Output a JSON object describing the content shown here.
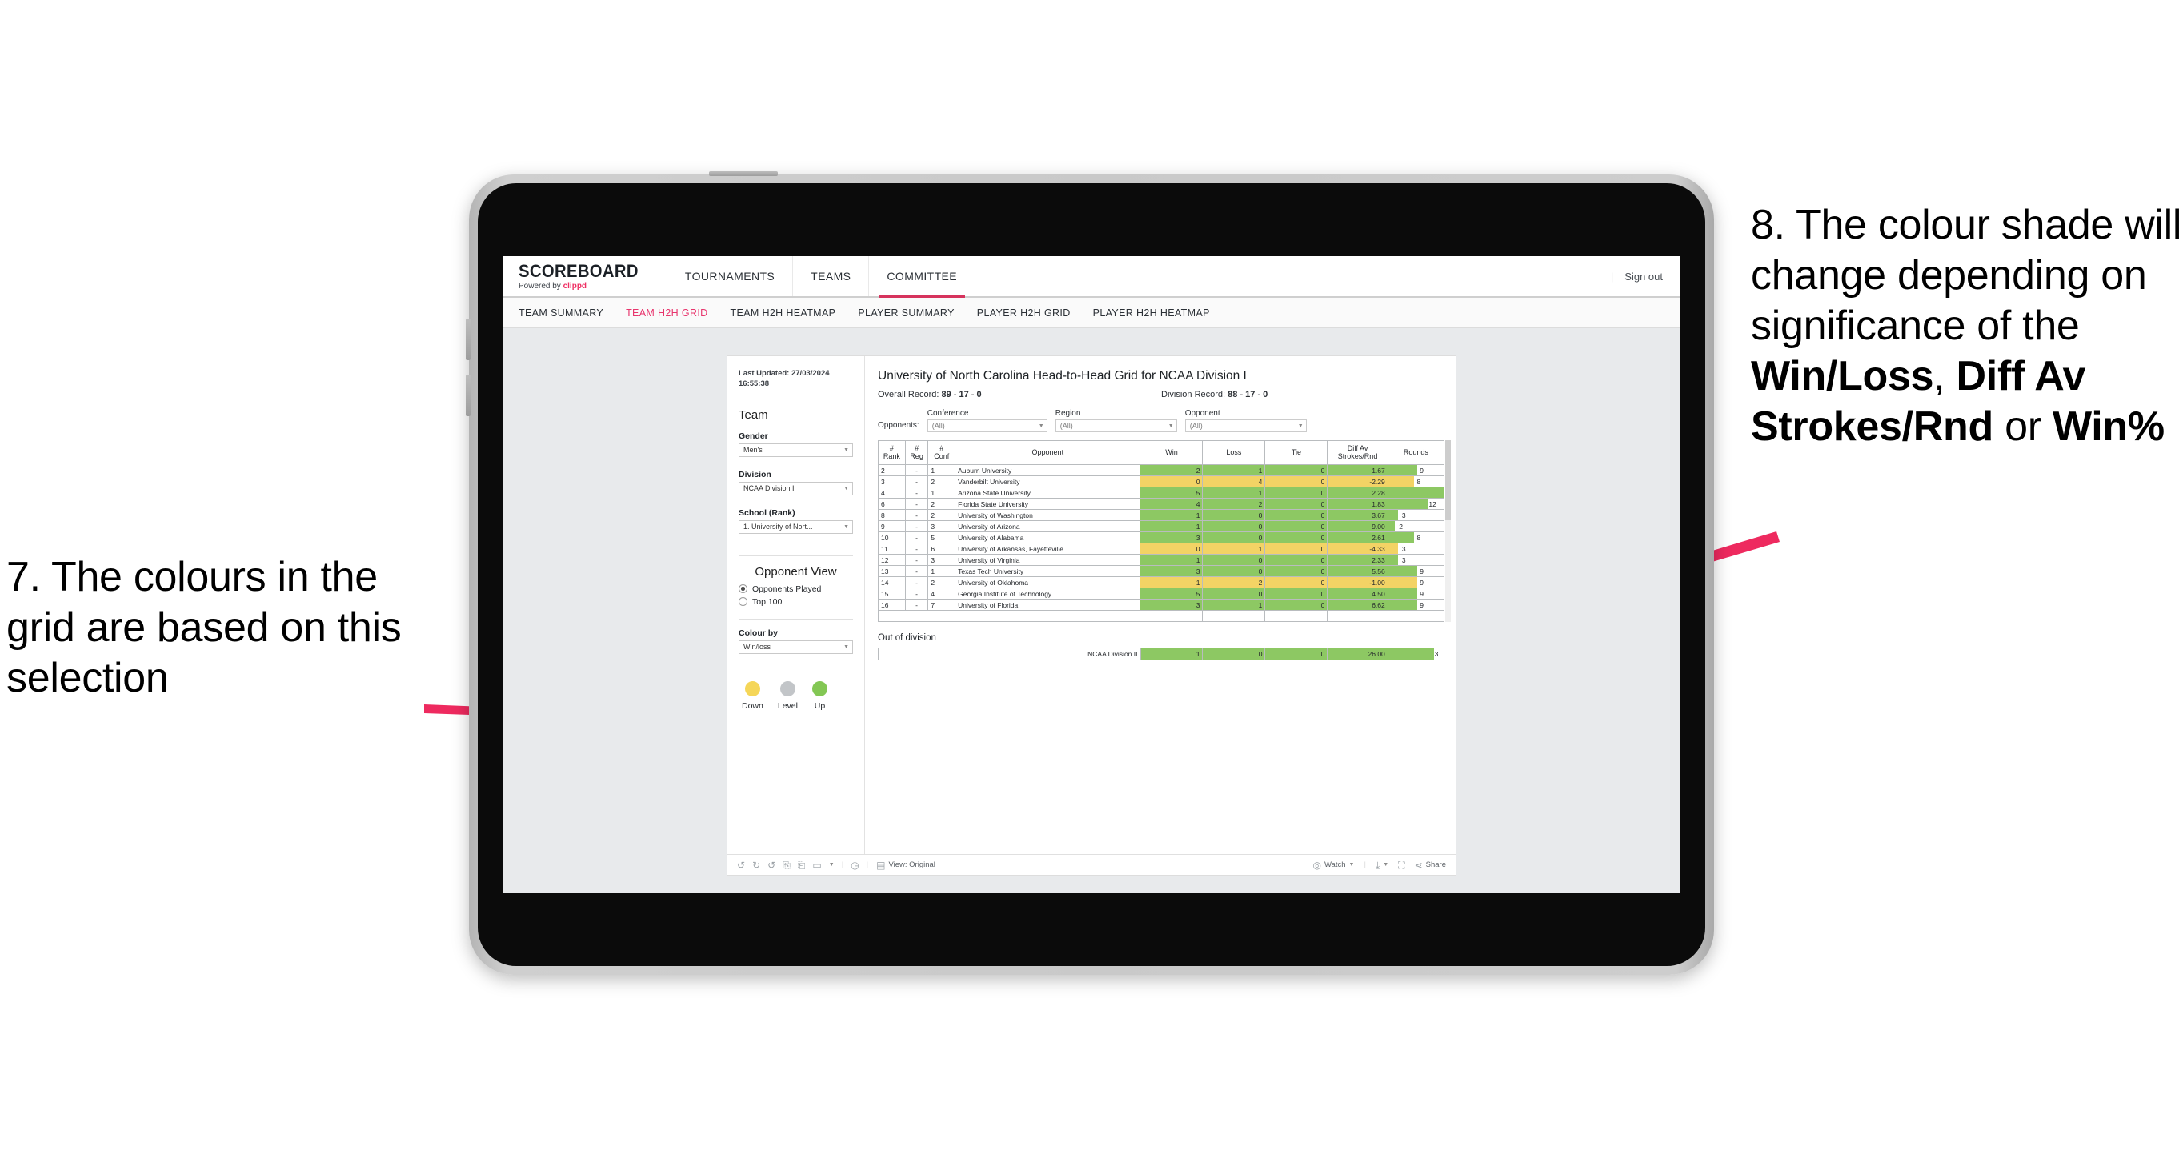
{
  "annotations": {
    "left": {
      "text": "7. The colours in the grid are based on this selection",
      "arrow_color": "#ee2a5f"
    },
    "right": {
      "line1": "8. The colour shade will change depending on significance of the ",
      "bold1": "Win/Loss",
      "mid1": ", ",
      "bold2": "Diff Av Strokes/Rnd",
      "mid2": " or ",
      "bold3": "Win%",
      "arrow_color": "#ee2a5f"
    }
  },
  "app": {
    "brand": {
      "title": "SCOREBOARD",
      "powered_by": "Powered by",
      "accent_name": "clippd"
    },
    "topnav": [
      {
        "label": "TOURNAMENTS",
        "active": false
      },
      {
        "label": "TEAMS",
        "active": false
      },
      {
        "label": "COMMITTEE",
        "active": true
      }
    ],
    "signout": {
      "divider": "|",
      "label": "Sign out"
    },
    "subnav": [
      {
        "label": "TEAM SUMMARY",
        "active": false
      },
      {
        "label": "TEAM H2H GRID",
        "active": true
      },
      {
        "label": "TEAM H2H HEATMAP",
        "active": false
      },
      {
        "label": "PLAYER SUMMARY",
        "active": false
      },
      {
        "label": "PLAYER H2H GRID",
        "active": false
      },
      {
        "label": "PLAYER H2H HEATMAP",
        "active": false
      }
    ]
  },
  "sidebar": {
    "last_updated_label": "Last Updated:",
    "last_updated_value": "27/03/2024 16:55:38",
    "team_section_title": "Team",
    "fields": [
      {
        "label": "Gender",
        "value": "Men's"
      },
      {
        "label": "Division",
        "value": "NCAA Division I"
      },
      {
        "label": "School (Rank)",
        "value": "1. University of Nort..."
      }
    ],
    "opponent_view": {
      "title": "Opponent View",
      "options": [
        {
          "label": "Opponents Played",
          "selected": true
        },
        {
          "label": "Top 100",
          "selected": false
        }
      ]
    },
    "colour_by": {
      "label": "Colour by",
      "value": "Win/loss"
    },
    "legend": [
      {
        "label": "Down",
        "color": "#f5d658"
      },
      {
        "label": "Level",
        "color": "#c2c5c8"
      },
      {
        "label": "Up",
        "color": "#83c754"
      }
    ]
  },
  "main": {
    "title": "University of North Carolina Head-to-Head Grid for NCAA Division I",
    "overall_record_label": "Overall Record:",
    "overall_record_value": "89 - 17 - 0",
    "division_record_label": "Division Record:",
    "division_record_value": "88 - 17 - 0",
    "opponents_label": "Opponents:",
    "filters": [
      {
        "label": "Conference",
        "value": "(All)"
      },
      {
        "label": "Region",
        "value": "(All)"
      },
      {
        "label": "Opponent",
        "value": "(All)"
      }
    ],
    "out_of_division_label": "Out of division"
  },
  "chart_data": {
    "type": "table",
    "title": "University of North Carolina Head-to-Head Grid for NCAA Division I",
    "columns": [
      "# Rank",
      "# Reg",
      "# Conf",
      "Opponent",
      "Win",
      "Loss",
      "Tie",
      "Diff Av Strokes/Rnd",
      "Rounds"
    ],
    "column_headers_split": [
      {
        "l1": "#",
        "l2": "Rank"
      },
      {
        "l1": "#",
        "l2": "Reg"
      },
      {
        "l1": "#",
        "l2": "Conf"
      },
      {
        "l1": "",
        "l2": "Opponent"
      },
      {
        "l1": "",
        "l2": "Win"
      },
      {
        "l1": "",
        "l2": "Loss"
      },
      {
        "l1": "",
        "l2": "Tie"
      },
      {
        "l1": "Diff Av",
        "l2": "Strokes/Rnd"
      },
      {
        "l1": "",
        "l2": "Rounds"
      }
    ],
    "colors": {
      "up": "#8dc863",
      "down": "#f3d365",
      "level": "#c2c5c8",
      "rounds_bar": "#8dc863",
      "rounds_bar_down": "#f3d365"
    },
    "rounds_max": 17,
    "rows": [
      {
        "rank": "2",
        "reg": "-",
        "conf": "1",
        "opponent": "Auburn University",
        "win": "2",
        "loss": "1",
        "tie": "0",
        "diff": "1.67",
        "rounds": "9",
        "state": "up"
      },
      {
        "rank": "3",
        "reg": "-",
        "conf": "2",
        "opponent": "Vanderbilt University",
        "win": "0",
        "loss": "4",
        "tie": "0",
        "diff": "-2.29",
        "rounds": "8",
        "state": "down"
      },
      {
        "rank": "4",
        "reg": "-",
        "conf": "1",
        "opponent": "Arizona State University",
        "win": "5",
        "loss": "1",
        "tie": "0",
        "diff": "2.28",
        "rounds": "17",
        "state": "up"
      },
      {
        "rank": "6",
        "reg": "-",
        "conf": "2",
        "opponent": "Florida State University",
        "win": "4",
        "loss": "2",
        "tie": "0",
        "diff": "1.83",
        "rounds": "12",
        "state": "up"
      },
      {
        "rank": "8",
        "reg": "-",
        "conf": "2",
        "opponent": "University of Washington",
        "win": "1",
        "loss": "0",
        "tie": "0",
        "diff": "3.67",
        "rounds": "3",
        "state": "up"
      },
      {
        "rank": "9",
        "reg": "-",
        "conf": "3",
        "opponent": "University of Arizona",
        "win": "1",
        "loss": "0",
        "tie": "0",
        "diff": "9.00",
        "rounds": "2",
        "state": "up"
      },
      {
        "rank": "10",
        "reg": "-",
        "conf": "5",
        "opponent": "University of Alabama",
        "win": "3",
        "loss": "0",
        "tie": "0",
        "diff": "2.61",
        "rounds": "8",
        "state": "up"
      },
      {
        "rank": "11",
        "reg": "-",
        "conf": "6",
        "opponent": "University of Arkansas, Fayetteville",
        "win": "0",
        "loss": "1",
        "tie": "0",
        "diff": "-4.33",
        "rounds": "3",
        "state": "down"
      },
      {
        "rank": "12",
        "reg": "-",
        "conf": "3",
        "opponent": "University of Virginia",
        "win": "1",
        "loss": "0",
        "tie": "0",
        "diff": "2.33",
        "rounds": "3",
        "state": "up"
      },
      {
        "rank": "13",
        "reg": "-",
        "conf": "1",
        "opponent": "Texas Tech University",
        "win": "3",
        "loss": "0",
        "tie": "0",
        "diff": "5.56",
        "rounds": "9",
        "state": "up"
      },
      {
        "rank": "14",
        "reg": "-",
        "conf": "2",
        "opponent": "University of Oklahoma",
        "win": "1",
        "loss": "2",
        "tie": "0",
        "diff": "-1.00",
        "rounds": "9",
        "state": "down"
      },
      {
        "rank": "15",
        "reg": "-",
        "conf": "4",
        "opponent": "Georgia Institute of Technology",
        "win": "5",
        "loss": "0",
        "tie": "0",
        "diff": "4.50",
        "rounds": "9",
        "state": "up"
      },
      {
        "rank": "16",
        "reg": "-",
        "conf": "7",
        "opponent": "University of Florida",
        "win": "3",
        "loss": "1",
        "tie": "0",
        "diff": "6.62",
        "rounds": "9",
        "state": "up"
      }
    ],
    "out_of_division_rows": [
      {
        "opponent": "NCAA Division II",
        "win": "1",
        "loss": "0",
        "tie": "0",
        "diff": "26.00",
        "rounds": "3",
        "state": "up"
      }
    ]
  },
  "toolbar": {
    "icons": [
      "undo-icon",
      "redo-icon",
      "revert-icon",
      "refresh-data-icon",
      "pause-icon",
      "highlight-icon",
      "caret-down-icon",
      "clock-icon"
    ],
    "view_label": "View: Original",
    "watch_label": "Watch",
    "share_label": "Share"
  }
}
